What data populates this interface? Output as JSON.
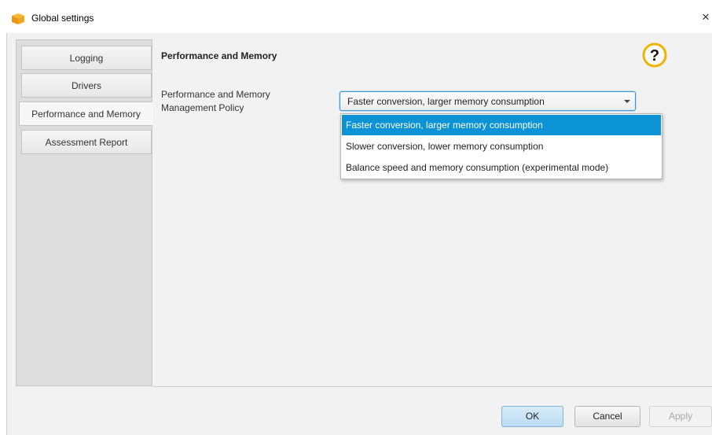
{
  "window": {
    "title": "Global settings",
    "close_glyph": "×",
    "app_icon": "amber-box-icon"
  },
  "sidebar": {
    "tabs": [
      {
        "label": "Logging",
        "selected": false
      },
      {
        "label": "Drivers",
        "selected": false
      },
      {
        "label": "Performance and Memory",
        "selected": true
      },
      {
        "label": "Assessment Report",
        "selected": false
      }
    ]
  },
  "content": {
    "section_title": "Performance and Memory",
    "help_icon": "question-mark-icon",
    "policy_label_line1": "Performance and Memory",
    "policy_label_line2": "Management Policy",
    "combo_value": "Faster conversion, larger memory consumption",
    "options": [
      "Faster conversion, larger memory consumption",
      "Slower conversion, lower memory consumption",
      "Balance speed and memory consumption (experimental mode)"
    ],
    "selected_option_index": 0
  },
  "footer": {
    "ok_label": "OK",
    "cancel_label": "Cancel",
    "apply_label": "Apply",
    "apply_enabled": false
  },
  "colors": {
    "accent": "#0b93d5",
    "combo_focus": "#3c96d3",
    "help_icon": "#f0b400"
  }
}
